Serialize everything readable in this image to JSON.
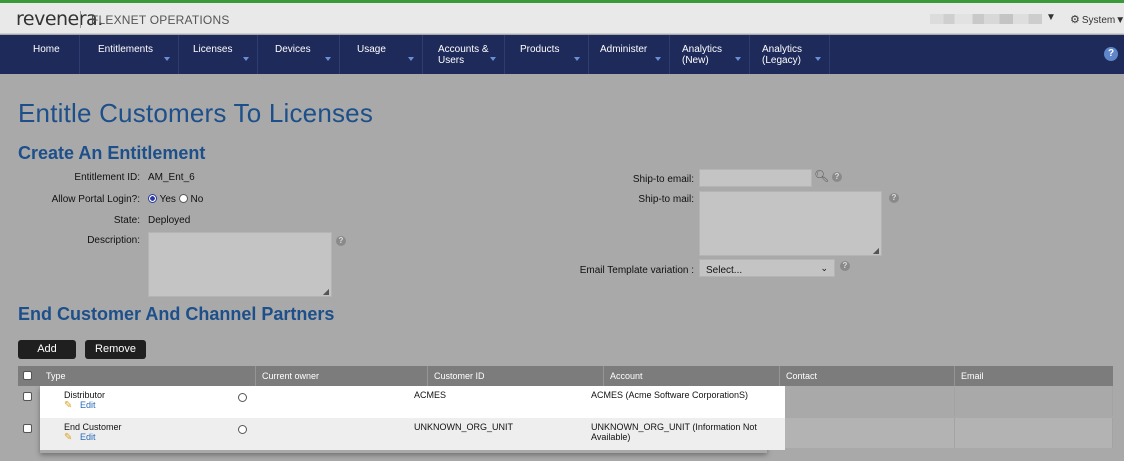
{
  "header": {
    "logo": "revenera.",
    "product": "FLEXNET OPERATIONS",
    "user_caret": "▼",
    "system": "System",
    "system_caret": "▼"
  },
  "nav": {
    "items": [
      {
        "label": "Home",
        "label2": "",
        "caret": false
      },
      {
        "label": "Entitlements",
        "label2": "",
        "caret": true
      },
      {
        "label": "Licenses",
        "label2": "",
        "caret": true
      },
      {
        "label": "Devices",
        "label2": "",
        "caret": true
      },
      {
        "label": "Usage",
        "label2": "",
        "caret": true
      },
      {
        "label": "Accounts &",
        "label2": "Users",
        "caret": true
      },
      {
        "label": "Products",
        "label2": "",
        "caret": true
      },
      {
        "label": "Administer",
        "label2": "",
        "caret": true
      },
      {
        "label": "Analytics",
        "label2": "(New)",
        "caret": true
      },
      {
        "label": "Analytics",
        "label2": "(Legacy)",
        "caret": true
      }
    ],
    "help": "?"
  },
  "page": {
    "title": "Entitle Customers To Licenses",
    "section1": "Create An Entitlement",
    "section2": "End Customer And Channel Partners"
  },
  "form": {
    "entitlement_id_label": "Entitlement ID:",
    "entitlement_id": "AM_Ent_6",
    "portal_label": "Allow Portal Login?:",
    "portal_yes": "Yes",
    "portal_no": "No",
    "state_label": "State:",
    "state": "Deployed",
    "description_label": "Description:",
    "description": "",
    "ship_email_label": "Ship-to email:",
    "ship_email": "",
    "ship_mail_label": "Ship-to mail:",
    "ship_mail": "",
    "template_label": "Email Template variation :",
    "template_value": "Select..."
  },
  "actions": {
    "add": "Add",
    "remove": "Remove"
  },
  "table": {
    "headers": [
      "Type",
      "Current owner",
      "Customer ID",
      "Account",
      "Contact",
      "Email"
    ],
    "rows": [
      {
        "type": "Distributor",
        "edit": "Edit",
        "customer_id": "ACMES",
        "account_1": "ACMES (Acme Software CorporationS)",
        "account_2": ""
      },
      {
        "type": "End Customer",
        "edit": "Edit",
        "customer_id": "UNKNOWN_ORG_UNIT",
        "account_1": "UNKNOWN_ORG_UNIT (Information Not",
        "account_2": "Available)"
      }
    ]
  }
}
